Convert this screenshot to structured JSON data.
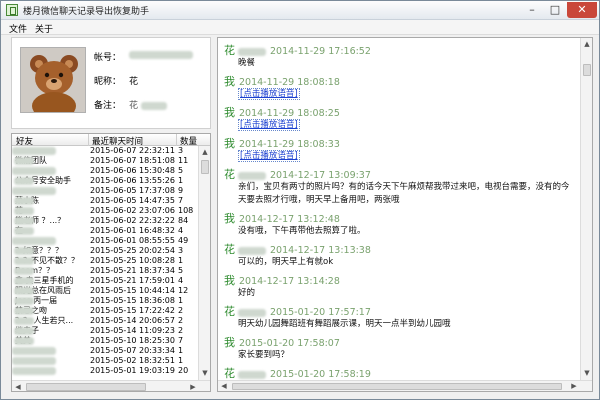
{
  "window": {
    "title": "楼月微信聊天记录导出恢复助手",
    "minimize": "–",
    "maximize": "□",
    "close": "✕"
  },
  "menu": {
    "file": "文件",
    "about": "关于"
  },
  "profile": {
    "account_label": "帐号：",
    "nickname_label": "昵称：",
    "nickname_value": "花",
    "remark_label": "备注：",
    "remark_value": "花"
  },
  "contacts": {
    "headers": {
      "name": "好友",
      "time": "最近聊天时间",
      "count": "数量"
    },
    "rows": [
      {
        "name": "",
        "time": "2015-06-07 22:32:11",
        "count": "3"
      },
      {
        "name": "微信团队",
        "time": "2015-06-07 18:51:08",
        "count": "11"
      },
      {
        "name": "",
        "time": "2015-06-06 15:30:48",
        "count": "5"
      },
      {
        "name": "公众号安全助手",
        "time": "2015-06-06 13:55:26",
        "count": "1"
      },
      {
        "name": "",
        "time": "2015-06-05 17:37:08",
        "count": "9"
      },
      {
        "name": "菜小陈",
        "time": "2015-06-05 14:47:35",
        "count": "7"
      },
      {
        "name": "花",
        "time": "2015-06-02 23:07:06",
        "count": "108"
      },
      {
        "name": "熊老师 ？...？",
        "time": "2015-06-02 22:32:22",
        "count": "84"
      },
      {
        "name": "在",
        "time": "2015-06-01 16:48:32",
        "count": "4"
      },
      {
        "name": "",
        "time": "2015-06-01 08:55:55",
        "count": "49"
      },
      {
        "name": "？如意？？？",
        "time": "2015-05-25 20:02:54",
        "count": "3"
      },
      {
        "name": "？？不见不散？？",
        "time": "2015-05-25 10:08:28",
        "count": "1"
      },
      {
        "name": "Boom？？",
        "time": "2015-05-21 18:37:34",
        "count": "5"
      },
      {
        "name": "鑫 卖三星手机的",
        "time": "2015-05-21 17:59:01",
        "count": "4"
      },
      {
        "name": "阳光总在风雨后",
        "time": "2015-05-15 10:44:14",
        "count": "12"
      },
      {
        "name": "Jess 丙一届",
        "time": "2015-05-15 18:36:08",
        "count": "1"
      },
      {
        "name": "禁忌之吻",
        "time": "2015-05-15 17:22:42",
        "count": "2"
      },
      {
        "name": "？？ 人生若只...",
        "time": "2015-05-14 20:06:57",
        "count": "2"
      },
      {
        "name": "继夫子",
        "time": "2015-05-14 11:09:23",
        "count": "2"
      },
      {
        "name": "美美",
        "time": "2015-05-10 18:25:30",
        "count": "7"
      },
      {
        "name": "",
        "time": "2015-05-07 20:33:34",
        "count": "1"
      },
      {
        "name": "",
        "time": "2015-05-02 18:32:51",
        "count": "1"
      },
      {
        "name": "",
        "time": "2015-05-01 19:03:19",
        "count": "20"
      }
    ]
  },
  "chat": [
    {
      "sender": "花",
      "time": "2014-11-29 17:16:52",
      "lines": [
        "晚餐"
      ],
      "type": "text"
    },
    {
      "sender": "我",
      "time": "2014-11-29 18:08:18",
      "lines": [
        "[点击播放语音]"
      ],
      "type": "voice"
    },
    {
      "sender": "我",
      "time": "2014-11-29 18:08:25",
      "lines": [
        "[点击播放语音]"
      ],
      "type": "voice"
    },
    {
      "sender": "我",
      "time": "2014-11-29 18:08:33",
      "lines": [
        "[点击播放语音]"
      ],
      "type": "voice"
    },
    {
      "sender": "花",
      "time": "2014-12-17 13:09:37",
      "lines": [
        "亲们，宝贝有两寸的照片吗？有的话今天下午麻烦帮我带过来吧，电视台需要，没有的今",
        "天要去照才行哦，明天早上备用吧，两张哦"
      ],
      "type": "text"
    },
    {
      "sender": "我",
      "time": "2014-12-17 13:12:48",
      "lines": [
        "没有哦，下午再带他去照算了啦。"
      ],
      "type": "text"
    },
    {
      "sender": "花",
      "time": "2014-12-17 13:13:38",
      "lines": [
        "可以的，明天早上有就ok"
      ],
      "type": "text"
    },
    {
      "sender": "我",
      "time": "2014-12-17 13:14:28",
      "lines": [
        "好的"
      ],
      "type": "text"
    },
    {
      "sender": "花",
      "time": "2015-01-20 17:57:17",
      "lines": [
        "明天幼儿园舞蹈班有舞蹈展示课，明天一点半到幼儿园哦"
      ],
      "type": "text"
    },
    {
      "sender": "我",
      "time": "2015-01-20 17:58:07",
      "lines": [
        "家长要到吗？"
      ],
      "type": "text"
    },
    {
      "sender": "花",
      "time": "2015-01-20 17:58:19",
      "lines": [
        ""
      ],
      "type": "text"
    }
  ],
  "scroll": {
    "up": "▲",
    "down": "▼",
    "left": "◀",
    "right": "▶"
  },
  "colors": {
    "sender_green": "#2e8b2e",
    "timestamp_green": "#7aa26e",
    "link_blue": "#1a3fd0"
  }
}
